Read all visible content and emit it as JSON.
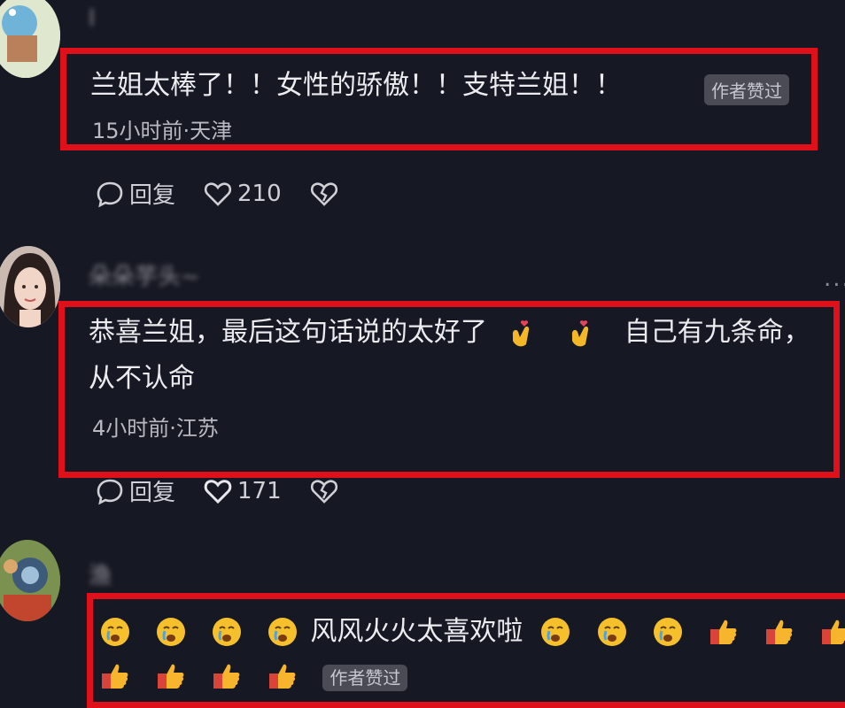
{
  "comments": [
    {
      "username": "l",
      "text": "兰姐太棒了！！女性的骄傲！！支特兰姐！！",
      "author_badge": "作者赞过",
      "meta": "15小时前·天津",
      "reply_label": "回复",
      "likes": "210"
    },
    {
      "username": "朵朵芋头~",
      "line1": "恭喜兰姐，最后这句话说的太好了",
      "line1_tail": "自己有九条命，",
      "line2": "从不认命",
      "meta": "4小时前·江苏",
      "reply_label": "回复",
      "likes": "171",
      "more": "..."
    },
    {
      "username": "渔",
      "text": "风风火火太喜欢啦",
      "author_badge": "作者赞过"
    }
  ],
  "icons": {
    "reply": "comment-bubble-icon",
    "like": "heart-icon",
    "dislike": "broken-heart-icon",
    "finger_heart": "finger-heart-emoji",
    "crying": "crying-emoji",
    "thumbs_up": "thumbs-up-emoji"
  },
  "colors": {
    "background": "#161823",
    "highlight_border": "#e0101a"
  }
}
